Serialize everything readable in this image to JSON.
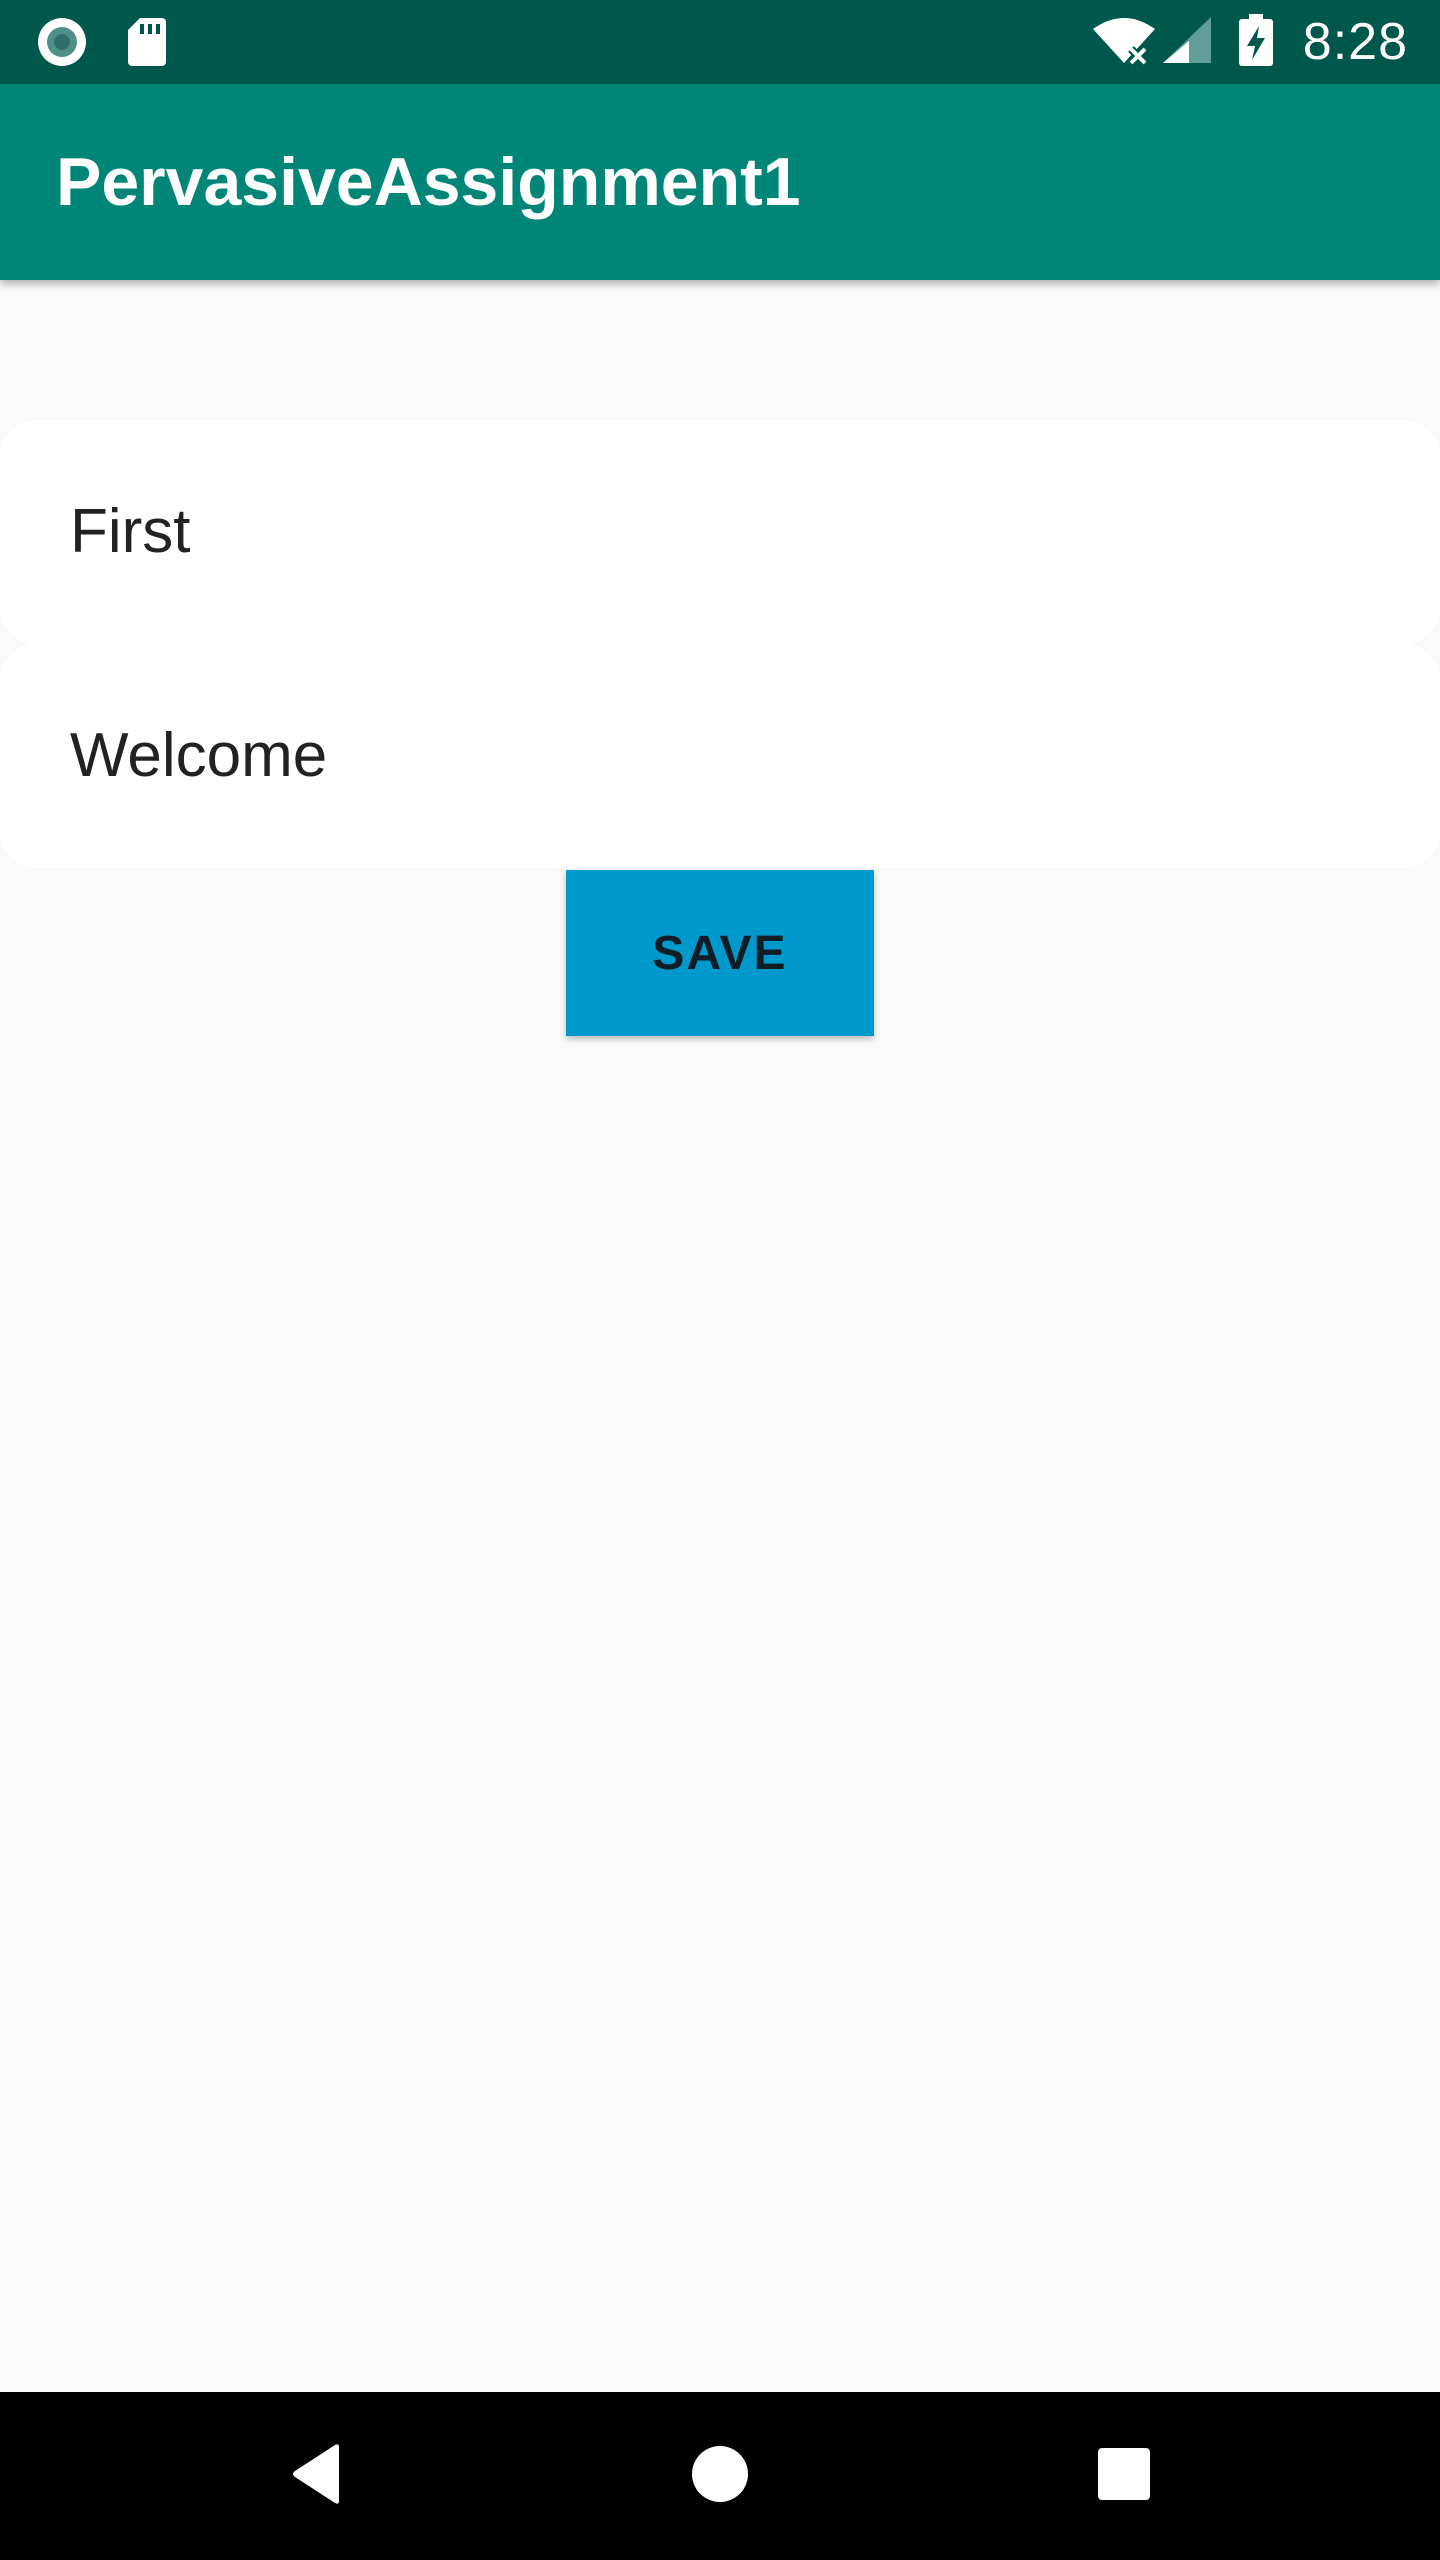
{
  "status_bar": {
    "time": "8:28",
    "icons_left": [
      "record-icon",
      "sd-card-icon"
    ],
    "icons_right": [
      "wifi-off-icon",
      "cell-signal-icon",
      "battery-charging-icon"
    ]
  },
  "app_bar": {
    "title": "PervasiveAssignment1"
  },
  "main": {
    "items": [
      {
        "label": "First"
      },
      {
        "label": "Welcome"
      }
    ],
    "save_button": {
      "label": "SAVE"
    }
  },
  "nav_bar": {
    "buttons": [
      "back-icon",
      "home-icon",
      "recents-icon"
    ]
  },
  "colors": {
    "status_bar": "#00574b",
    "app_bar": "#008577",
    "button": "#0099cc",
    "background": "#fafafa"
  }
}
